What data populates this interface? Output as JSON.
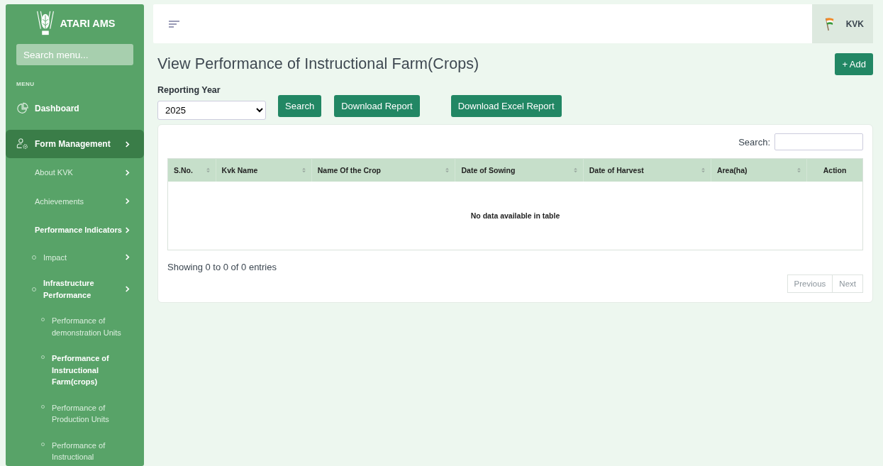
{
  "sidebar": {
    "brand": "ATARI AMS",
    "search": {
      "placeholder": "Search menu..."
    },
    "section_label": "MENU",
    "items": [
      {
        "label": "Dashboard",
        "selected": false
      },
      {
        "label": "Form Management",
        "kind": "submenu",
        "selected": true,
        "children": [
          {
            "label": "About KVK",
            "kind": "submenu",
            "selected": false
          },
          {
            "label": "Achievements",
            "kind": "submenu",
            "selected": false
          },
          {
            "label": "Performance Indicators",
            "kind": "submenu",
            "selected": true,
            "children": [
              {
                "label": "Impact",
                "kind": "submenu",
                "selected": false
              },
              {
                "label": "Infrastructure Performance",
                "kind": "submenu",
                "selected": true,
                "children": [
                  {
                    "label": "Performance of demonstration Units",
                    "selected": false
                  },
                  {
                    "label": "Performance of Instructional Farm(crops)",
                    "selected": true
                  },
                  {
                    "label": "Performance of Production Units",
                    "selected": false
                  },
                  {
                    "label": "Performance of Instructional",
                    "selected": false
                  }
                ]
              }
            ]
          }
        ]
      }
    ]
  },
  "header": {
    "user": "KVK"
  },
  "page": {
    "title": "View Performance of Instructional Farm(Crops)",
    "add_button": "+ Add",
    "filter": {
      "label": "Reporting Year",
      "value": "2025"
    },
    "buttons": [
      "Search",
      "Download Report",
      "Download Excel Report"
    ],
    "table": {
      "search_label": "Search:",
      "columns": [
        {
          "label": "S.No.",
          "sortable": true
        },
        {
          "label": "Kvk Name",
          "sortable": true
        },
        {
          "label": "Name Of the Crop",
          "sortable": true
        },
        {
          "label": "Date of Sowing",
          "sortable": true
        },
        {
          "label": "Date of Harvest",
          "sortable": true
        },
        {
          "label": "Area(ha)",
          "sortable": true
        },
        {
          "label": "Action",
          "sortable": false
        }
      ],
      "empty_message": "No data available in table",
      "info": "Showing 0 to 0 of 0 entries",
      "pagination": [
        {
          "label": "Previous",
          "disabled": true
        },
        {
          "label": "Next",
          "disabled": true
        }
      ]
    }
  }
}
